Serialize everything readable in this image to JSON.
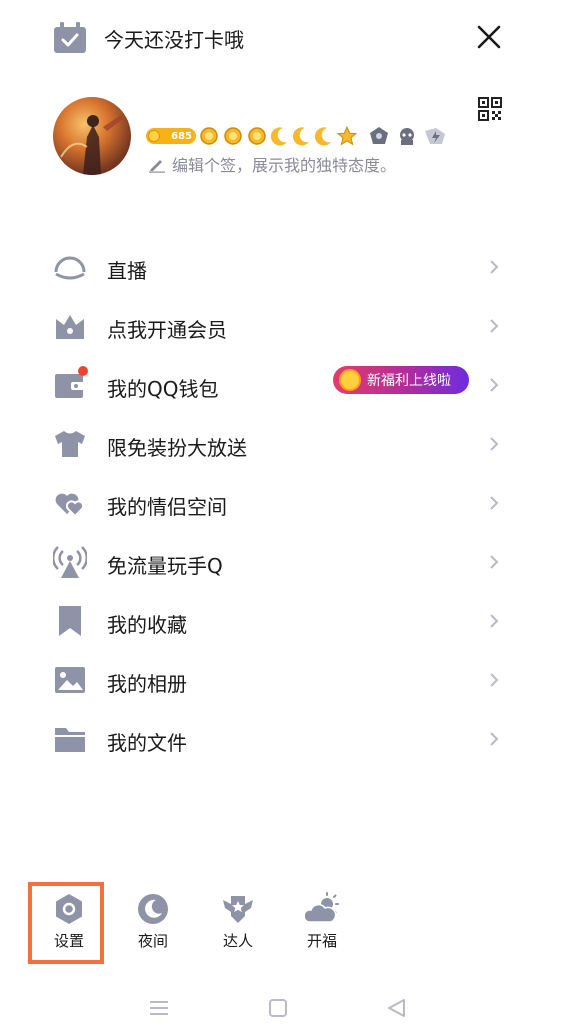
{
  "header": {
    "checkin_text": "今天还没打卡哦",
    "level_number": "685",
    "signature": "编辑个签，展示我的独特态度。"
  },
  "menu": {
    "items": [
      {
        "label": "直播",
        "icon": "live-icon"
      },
      {
        "label": "点我开通会员",
        "icon": "vip-crown-icon"
      },
      {
        "label": "我的QQ钱包",
        "icon": "wallet-icon",
        "badge": "新福利上线啦"
      },
      {
        "label": "限免装扮大放送",
        "icon": "tshirt-icon"
      },
      {
        "label": "我的情侣空间",
        "icon": "couple-hearts-icon"
      },
      {
        "label": "免流量玩手Q",
        "icon": "signal-tower-icon"
      },
      {
        "label": "我的收藏",
        "icon": "bookmark-icon"
      },
      {
        "label": "我的相册",
        "icon": "photo-icon"
      },
      {
        "label": "我的文件",
        "icon": "folder-icon"
      }
    ]
  },
  "bottom": {
    "items": [
      {
        "label": "设置",
        "icon": "settings-icon"
      },
      {
        "label": "夜间",
        "icon": "moon-icon"
      },
      {
        "label": "达人",
        "icon": "winged-badge-icon"
      },
      {
        "label": "开福",
        "icon": "sun-cloud-icon"
      }
    ]
  },
  "colors": {
    "icon_gray": "#8e93a8",
    "highlight_orange": "#f4703d",
    "badge_gold": "#f7b21a",
    "promo_start": "#e43c6b",
    "promo_end": "#6e2ce0"
  }
}
